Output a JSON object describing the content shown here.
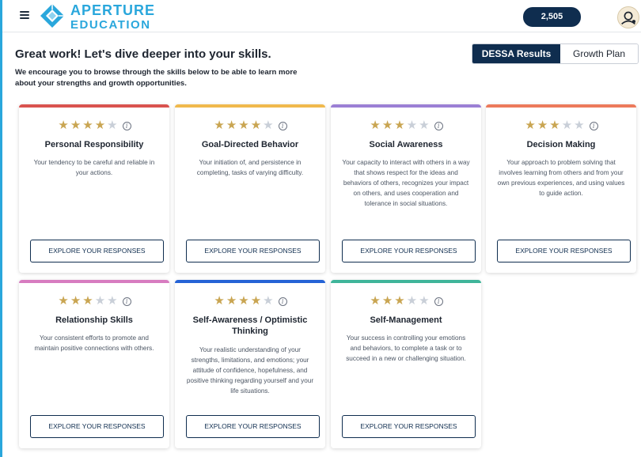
{
  "header": {
    "brand_line1": "APERTURE",
    "brand_line2": "EDUCATION",
    "points": "2,505"
  },
  "page": {
    "title": "Great work! Let's dive deeper into your skills.",
    "intro": "We encourage you to browse through the skills below to be able to learn more about your strengths and growth opportunities."
  },
  "tabs": {
    "active": "DESSA Results",
    "inactive": "Growth Plan"
  },
  "explore_label": "EXPLORE YOUR RESPONSES",
  "colors": {
    "brand": "#2aa7dc",
    "navy": "#0f2d4f",
    "star_on": "#c9a552",
    "star_off": "#c9cfd8"
  },
  "skills": [
    {
      "name": "Personal Responsibility",
      "rating": 4,
      "color": "#d9534f",
      "description": "Your tendency to be careful and reliable in your actions.",
      "button": "EXPLORE YOUR RESPONSES"
    },
    {
      "name": "Goal-Directed Behavior",
      "rating": 4,
      "color": "#f0b94d",
      "description": "Your initiation of, and persistence in completing, tasks of varying difficulty.",
      "button": "EXPLORE YOUR RESPONSES"
    },
    {
      "name": "Social Awareness",
      "rating": 3,
      "color": "#9b7fd4",
      "description": "Your capacity to interact with others in a way that shows respect for the ideas and behaviors of others, recognizes your impact on others, and uses cooperation and tolerance in social situations.",
      "button": "EXPLORE YOUR RESPONSES"
    },
    {
      "name": "Decision Making",
      "rating": 3,
      "color": "#ec7a5b",
      "description": "Your approach to problem solving that involves learning from others and from your own previous experiences, and using values to guide action.",
      "button": "EXPLORE YOUR RESPONSES"
    },
    {
      "name": "Relationship Skills",
      "rating": 3,
      "color": "#d77cc0",
      "description": "Your consistent efforts to promote and maintain positive connections with others.",
      "button": "EXPLORE YOUR RESPONSES"
    },
    {
      "name": "Self-Awareness / Optimistic Thinking",
      "rating": 4,
      "color": "#2563d6",
      "description": "Your realistic understanding of your strengths, limitations, and emotions; your attitude of confidence, hopefulness, and positive thinking regarding yourself and your life situations.",
      "button": "EXPLORE YOUR RESPONSES"
    },
    {
      "name": "Self-Management",
      "rating": 3,
      "color": "#3fb59a",
      "description": "Your success in controlling your emotions and behaviors, to complete a task or to succeed in a new or challenging situation.",
      "button": "EXPLORE YOUR RESPONSES"
    }
  ]
}
